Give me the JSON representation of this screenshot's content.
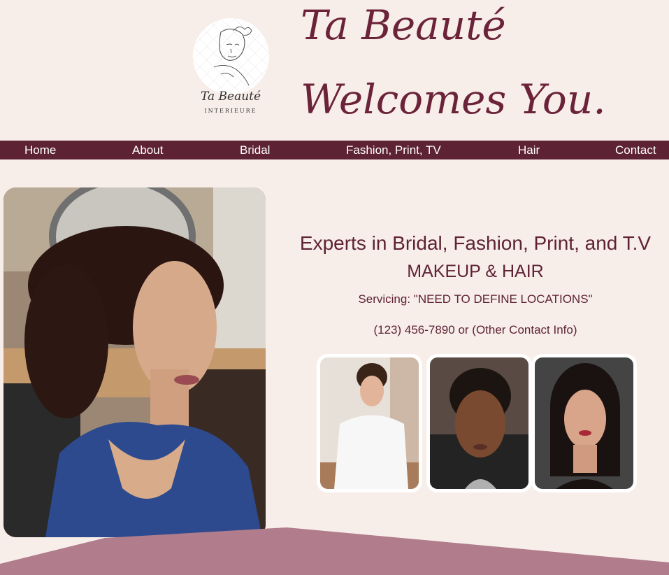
{
  "brand": {
    "logo_word": "Ta Beauté",
    "logo_sub": "INTERIEURE",
    "title_line1": "Ta Beauté",
    "title_line2": "Welcomes You."
  },
  "nav": {
    "items": [
      {
        "label": "Home"
      },
      {
        "label": "About"
      },
      {
        "label": "Bridal"
      },
      {
        "label": "Fashion, Print, TV"
      },
      {
        "label": "Hair"
      },
      {
        "label": "Contact"
      }
    ]
  },
  "hero": {
    "headline": "Experts in Bridal, Fashion, Print, and T.V",
    "subheadline": "MAKEUP & HAIR",
    "servicing": "Servicing: \"NEED TO DEFINE LOCATIONS\"",
    "contact": "(123) 456-7890 or (Other Contact Info)"
  },
  "colors": {
    "background": "#f8eee9",
    "nav_bg": "#5e2235",
    "brand_text": "#6b2339",
    "wave": "#b17c8c"
  }
}
